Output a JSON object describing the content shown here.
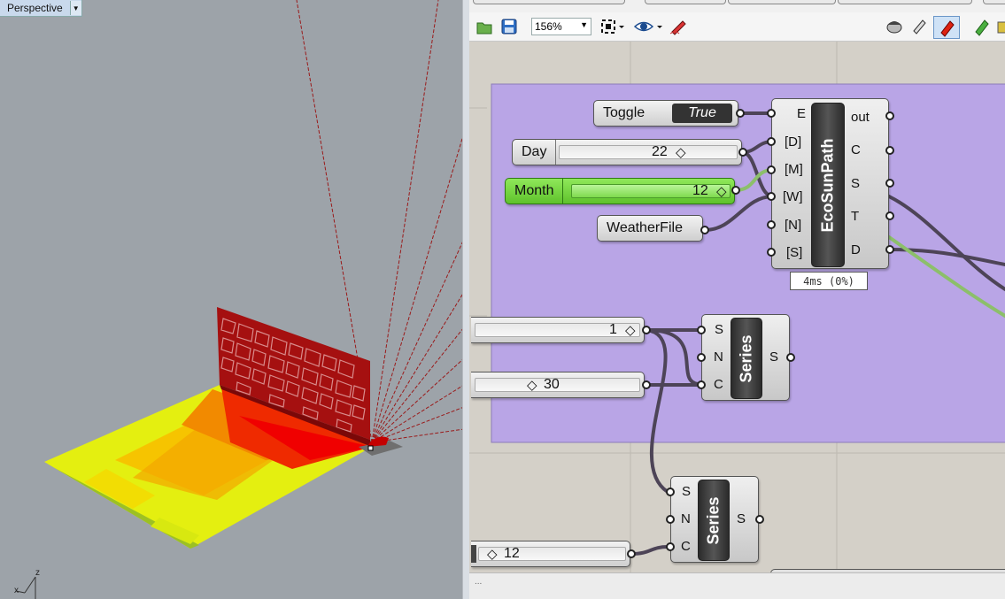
{
  "viewport": {
    "label": "Perspective",
    "axis_z": "z",
    "axis_x": "x"
  },
  "toolbar": {
    "zoom": "156%"
  },
  "canvas": {
    "toggle": {
      "name": "Toggle",
      "value": "True"
    },
    "day_slider": {
      "name": "Day",
      "value": "22"
    },
    "month_slider": {
      "name": "Month",
      "value": "12"
    },
    "weather": {
      "name": "WeatherFile"
    },
    "ecosun": {
      "title": "EcoSunPath",
      "inputs": [
        "E",
        "[D]",
        "[M]",
        "[W]",
        "[N]",
        "[S]"
      ],
      "outputs": [
        "out",
        "C",
        "S",
        "T",
        "D"
      ],
      "timing": "4ms (0%)"
    },
    "slider_a": {
      "value": "1"
    },
    "slider_b": {
      "value": "30"
    },
    "slider_c": {
      "value": "12"
    },
    "series1": {
      "title": "Series",
      "inputs": [
        "S",
        "N",
        "C"
      ],
      "output": "S"
    },
    "series2": {
      "title": "Series",
      "inputs": [
        "S",
        "N",
        "C"
      ],
      "output": "S"
    }
  },
  "status": {
    "text": "..."
  },
  "colors": {
    "group": "#b9a5e6",
    "month_green": "#6fd13a",
    "wire": "#4d4457",
    "wire_green": "#8cbf6a"
  }
}
